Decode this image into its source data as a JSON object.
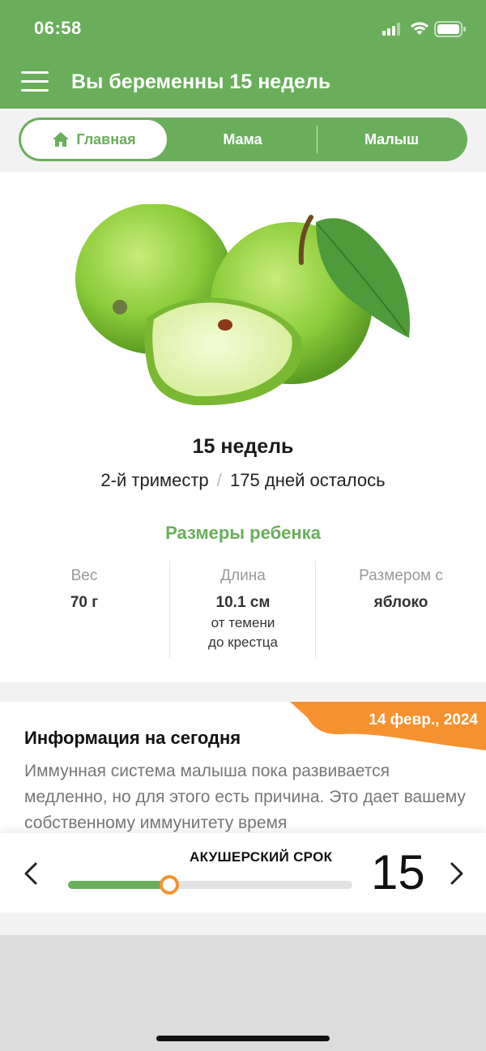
{
  "status": {
    "time": "06:58"
  },
  "header": {
    "title": "Вы беременны 15 недель"
  },
  "tabs": [
    {
      "label": "Главная",
      "active": true
    },
    {
      "label": "Мама",
      "active": false
    },
    {
      "label": "Малыш",
      "active": false
    }
  ],
  "summary": {
    "weeks": "15 недель",
    "trimester": "2-й триместр",
    "separator": "/",
    "days_left": "175 дней осталось"
  },
  "baby_sizes": {
    "title": "Размеры ребенка",
    "weight": {
      "label": "Вес",
      "value": "70 г"
    },
    "length": {
      "label": "Длина",
      "value": "10.1 см",
      "note_line1": "от темени",
      "note_line2": "до крестца"
    },
    "size_as": {
      "label": "Размером с",
      "value": "яблоко"
    }
  },
  "info": {
    "date": "14 февр., 2024",
    "title": "Информация на сегодня",
    "text": "Иммунная система малыша пока развивается медленно, но для этого есть причина. Это дает вашему собственному иммунитету время"
  },
  "term": {
    "label": "АКУШЕРСКИЙ СРОК",
    "week": "15",
    "progress": 0.357
  },
  "colors": {
    "brand_green": "#6aae5b",
    "accent_orange": "#f5922f"
  }
}
